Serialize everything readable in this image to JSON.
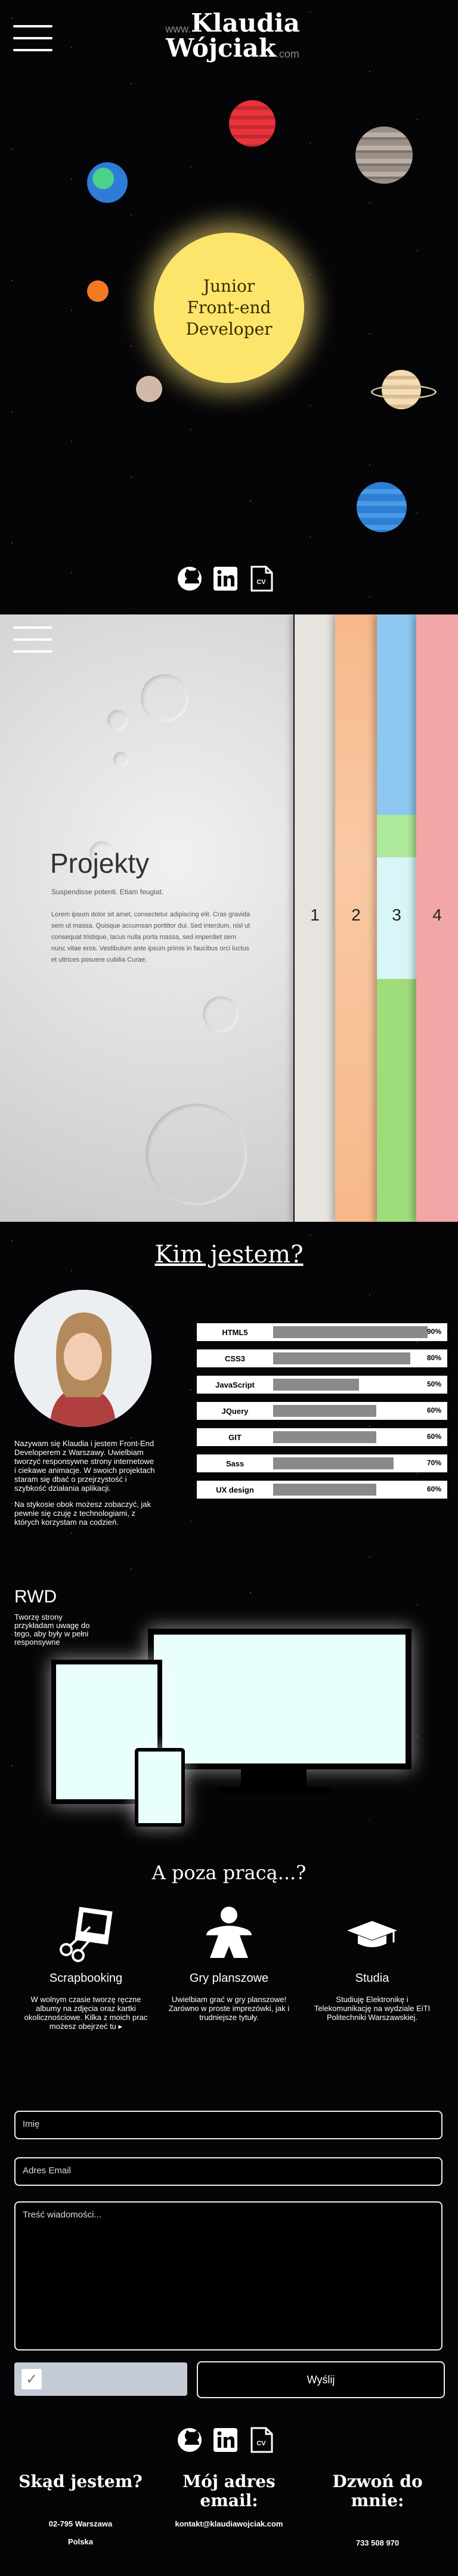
{
  "header": {
    "logo_prefix": "www.",
    "logo_line1": "Klaudia",
    "logo_line2": "Wójciak",
    "logo_suffix": ".com",
    "menu_icon": "hamburger-icon"
  },
  "hero": {
    "sun_text": "Junior\nFront-end\nDeveloper",
    "social": [
      {
        "icon": "github-icon"
      },
      {
        "icon": "linkedin-icon"
      },
      {
        "icon": "cv-icon",
        "label": "CV"
      }
    ]
  },
  "projects": {
    "title": "Projekty",
    "subtitle": "Suspendisse potenti. Etiam feugiat.",
    "text": "Lorem ipsum dolor sit amet, consectetur adipiscing elit. Cras gravida sem ut massa. Quisque accumsan porttitor dui. Sed interdum, nisl ut consequat tristique, lacus nulla porta massa, sed imperdiet sem nunc vitae eros. Vestibulum ante ipsum primis in faucibus orci luctus et ultrices posuere cubilia Curae;",
    "cards": [
      {
        "number": "1",
        "color": "#e7e4e0"
      },
      {
        "number": "2",
        "color": "#f7b88a"
      },
      {
        "number": "3",
        "color": "#8ec8f0"
      },
      {
        "number": "4",
        "color": "#f2a6a6"
      }
    ]
  },
  "about": {
    "heading": "Kim jestem?",
    "paragraphs": [
      "Nazywam się Klaudia i jestem Front-End Developerem z Warszawy. Uwielbiam tworzyć responsywne strony internetowe i ciekawe animacje. W swoich projektach staram się dbać o przejrzystość i szybkość działania aplikacji.",
      "Na stykosie obok możesz zobaczyć, jak pewnie się czuję z technologiami, z których korzystam na codzień."
    ],
    "skills": [
      {
        "name": "HTML5",
        "percent": 90,
        "label": "90%"
      },
      {
        "name": "CSS3",
        "percent": 80,
        "label": "80%"
      },
      {
        "name": "JavaScript",
        "percent": 50,
        "label": "50%"
      },
      {
        "name": "JQuery",
        "percent": 60,
        "label": "60%"
      },
      {
        "name": "GIT",
        "percent": 60,
        "label": "60%"
      },
      {
        "name": "Sass",
        "percent": 70,
        "label": "70%"
      },
      {
        "name": "UX design",
        "percent": 60,
        "label": "60%"
      }
    ],
    "rwd_title": "RWD",
    "rwd_text": "Tworzę strony przykładam uwagę do tego, aby były w pełni responsywne"
  },
  "hobbies": {
    "heading": "A poza pracą...?",
    "items": [
      {
        "icon": "scrapbook-icon",
        "title": "Scrapbooking",
        "desc": "W wolnym czasie tworzę ręczne albumy na zdjęcia oraz kartki okolicznościowe. Kilka z moich prac możesz obejrzeć tu ▸"
      },
      {
        "icon": "meeple-icon",
        "title": "Gry planszowe",
        "desc": "Uwielbiam grać w gry planszowe! Zarówno w proste imprezówki, jak i trudniejsze tytuły."
      },
      {
        "icon": "graduation-cap-icon",
        "title": "Studia",
        "desc": "Studiuję Elektronikę i Telekomunikację na wydziale EiTI Politechniki Warszawskiej."
      }
    ]
  },
  "contact": {
    "name_placeholder": "Imię",
    "email_placeholder": "Adres Email",
    "message_placeholder": "Treść wiadomości...",
    "submit_label": "Wyślij"
  },
  "footer": {
    "cols": [
      {
        "head": "Skąd jestem?",
        "lines": [
          "02-795 Warszawa",
          "Polska"
        ]
      },
      {
        "head": "Mój adres email:",
        "lines": [
          "kontakt@klaudiawojciak.com"
        ]
      },
      {
        "head": "Dzwoń do mnie:",
        "lines": [
          "733 508 970"
        ]
      }
    ]
  }
}
